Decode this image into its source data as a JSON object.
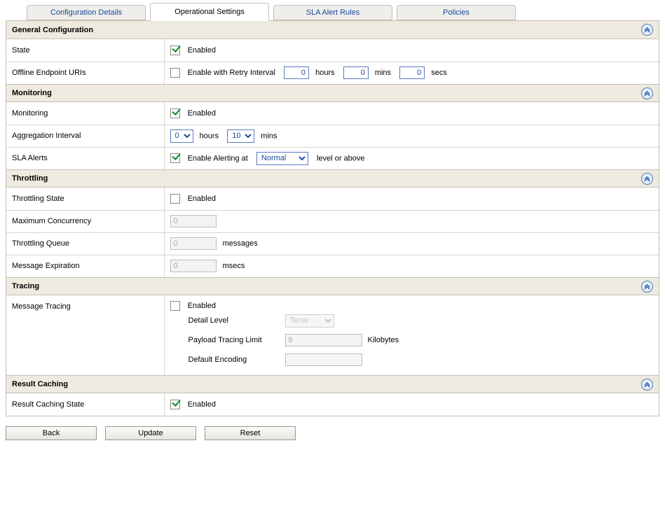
{
  "tabs": {
    "config_details": "Configuration Details",
    "operational_settings": "Operational Settings",
    "sla_rules": "SLA Alert Rules",
    "policies": "Policies"
  },
  "sections": {
    "general": "General Configuration",
    "monitoring": "Monitoring",
    "throttling": "Throttling",
    "tracing": "Tracing",
    "result_caching": "Result Caching"
  },
  "labels": {
    "state": "State",
    "offline_uris": "Offline Endpoint URIs",
    "monitoring": "Monitoring",
    "agg_interval": "Aggregation Interval",
    "sla_alerts": "SLA Alerts",
    "throttling_state": "Throttling State",
    "max_concurrency": "Maximum Concurrency",
    "throttling_queue": "Throttling Queue",
    "message_expiration": "Message Expiration",
    "message_tracing": "Message Tracing",
    "detail_level": "Detail Level",
    "payload_limit": "Payload Tracing Limit",
    "default_encoding": "Default Encoding",
    "result_caching_state": "Result Caching State"
  },
  "text": {
    "enabled": "Enabled",
    "enable_retry": "Enable with Retry Interval",
    "hours": "hours",
    "mins": "mins",
    "secs": "secs",
    "enable_alerting_at": "Enable Alerting at",
    "level_or_above": "level or above",
    "messages": "messages",
    "msecs": "msecs",
    "kilobytes": "Kilobytes"
  },
  "values": {
    "retry_hours": "0",
    "retry_mins": "0",
    "retry_secs": "0",
    "agg_hours": "0",
    "agg_mins": "10",
    "alert_level": "Normal",
    "max_concurrency": "0",
    "throttling_queue": "0",
    "message_expiration": "0",
    "detail_level": "Terse",
    "payload_limit": "8",
    "default_encoding": ""
  },
  "buttons": {
    "back": "Back",
    "update": "Update",
    "reset": "Reset"
  }
}
